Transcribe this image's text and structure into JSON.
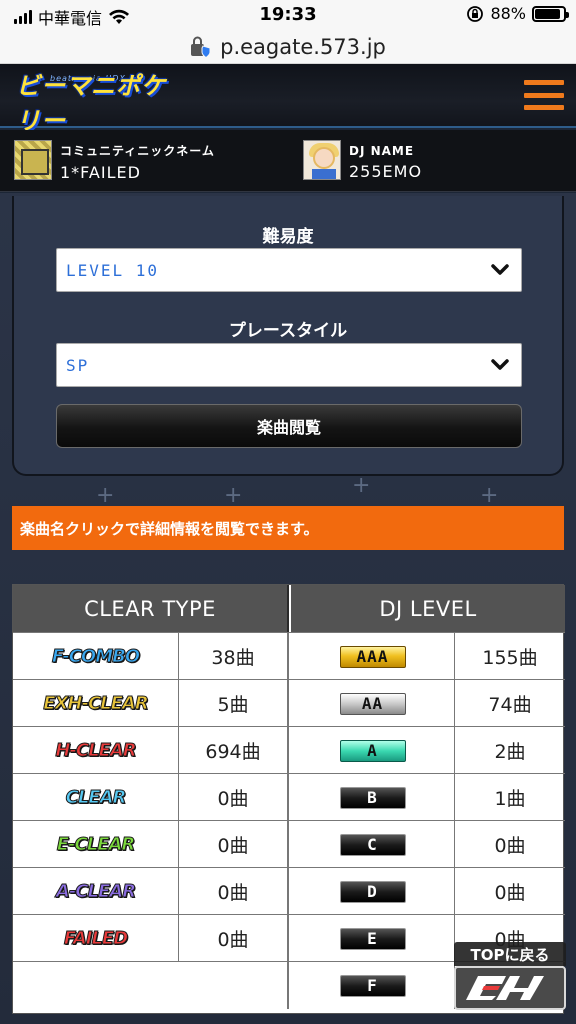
{
  "status_bar": {
    "carrier": "中華電信",
    "time": "19:33",
    "battery_percent": "88%",
    "battery_level": 0.88
  },
  "browser": {
    "url": "p.eagate.573.jp"
  },
  "header": {
    "logo_subtitle": "beatmania IIDX 28",
    "logo_text": "ビーマニポケリー",
    "menu_icon": "hamburger-icon"
  },
  "profile": {
    "community_label": "コミュニティニックネーム",
    "community_value": "1*FAILED",
    "dj_label": "DJ NAME",
    "dj_value": "255EMO"
  },
  "filters": {
    "difficulty_label": "難易度",
    "difficulty_value": "LEVEL 10",
    "play_style_label": "プレースタイル",
    "play_style_value": "SP",
    "browse_button": "楽曲閲覧"
  },
  "notice": "楽曲名クリックで詳細情報を閲覧できます。",
  "stats": {
    "clear_header": "CLEAR TYPE",
    "dj_header": "DJ LEVEL",
    "rows": [
      {
        "clear": "F-COMBO",
        "clear_count": "38曲",
        "dj": "AAA",
        "dj_count": "155曲"
      },
      {
        "clear": "EXH-CLEAR",
        "clear_count": "5曲",
        "dj": "AA",
        "dj_count": "74曲"
      },
      {
        "clear": "H-CLEAR",
        "clear_count": "694曲",
        "dj": "A",
        "dj_count": "2曲"
      },
      {
        "clear": "CLEAR",
        "clear_count": "0曲",
        "dj": "B",
        "dj_count": "1曲"
      },
      {
        "clear": "E-CLEAR",
        "clear_count": "0曲",
        "dj": "C",
        "dj_count": "0曲"
      },
      {
        "clear": "A-CLEAR",
        "clear_count": "0曲",
        "dj": "D",
        "dj_count": "0曲"
      },
      {
        "clear": "FAILED",
        "clear_count": "0曲",
        "dj": "E",
        "dj_count": "0曲"
      },
      {
        "clear": "",
        "clear_count": "",
        "dj": "F",
        "dj_count": ""
      }
    ],
    "clear_colors": [
      "#3aa8f0",
      "#e8c43a",
      "#e83a3a",
      "#56c8f2",
      "#7bd83c",
      "#8a6ce0",
      "#e83a3a",
      "#ffffff"
    ],
    "dj_styles": [
      "gold",
      "silver",
      "teal",
      "dark",
      "dark",
      "dark",
      "dark",
      "dark"
    ]
  },
  "floating": {
    "top_label": "TOPに戻る"
  }
}
